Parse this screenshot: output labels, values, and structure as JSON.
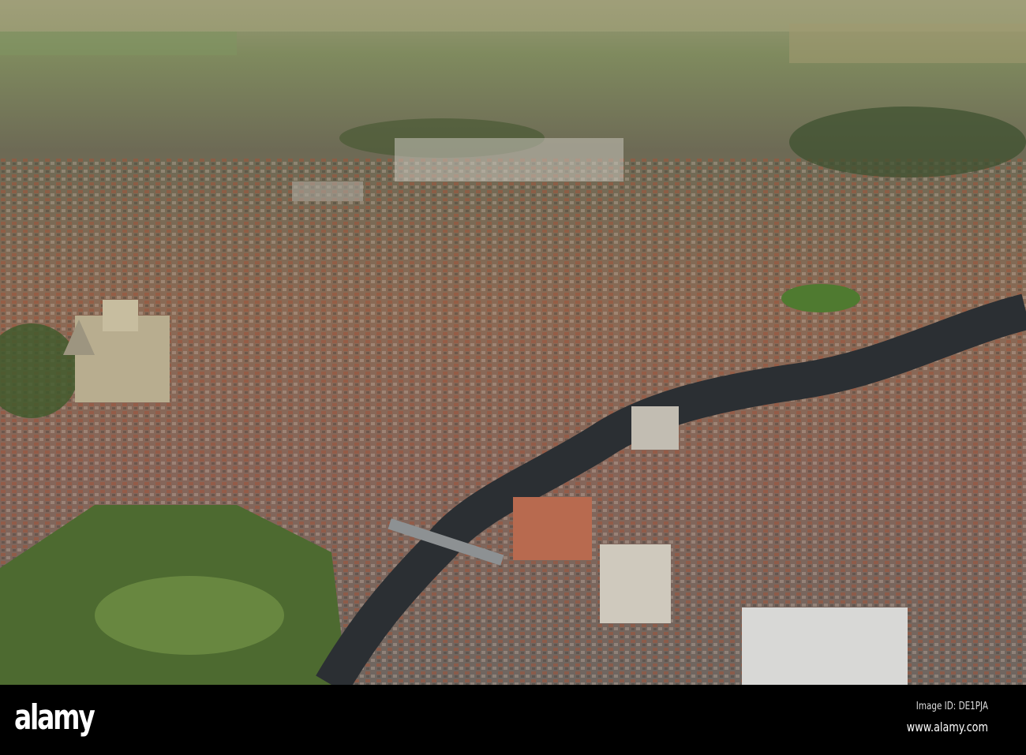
{
  "photo": {
    "subject": "Aerial view of a city with cathedral and river"
  },
  "banner": {
    "logo": "alamy",
    "image_id": "Image ID: DE1PJA",
    "website": "www.alamy.com"
  }
}
